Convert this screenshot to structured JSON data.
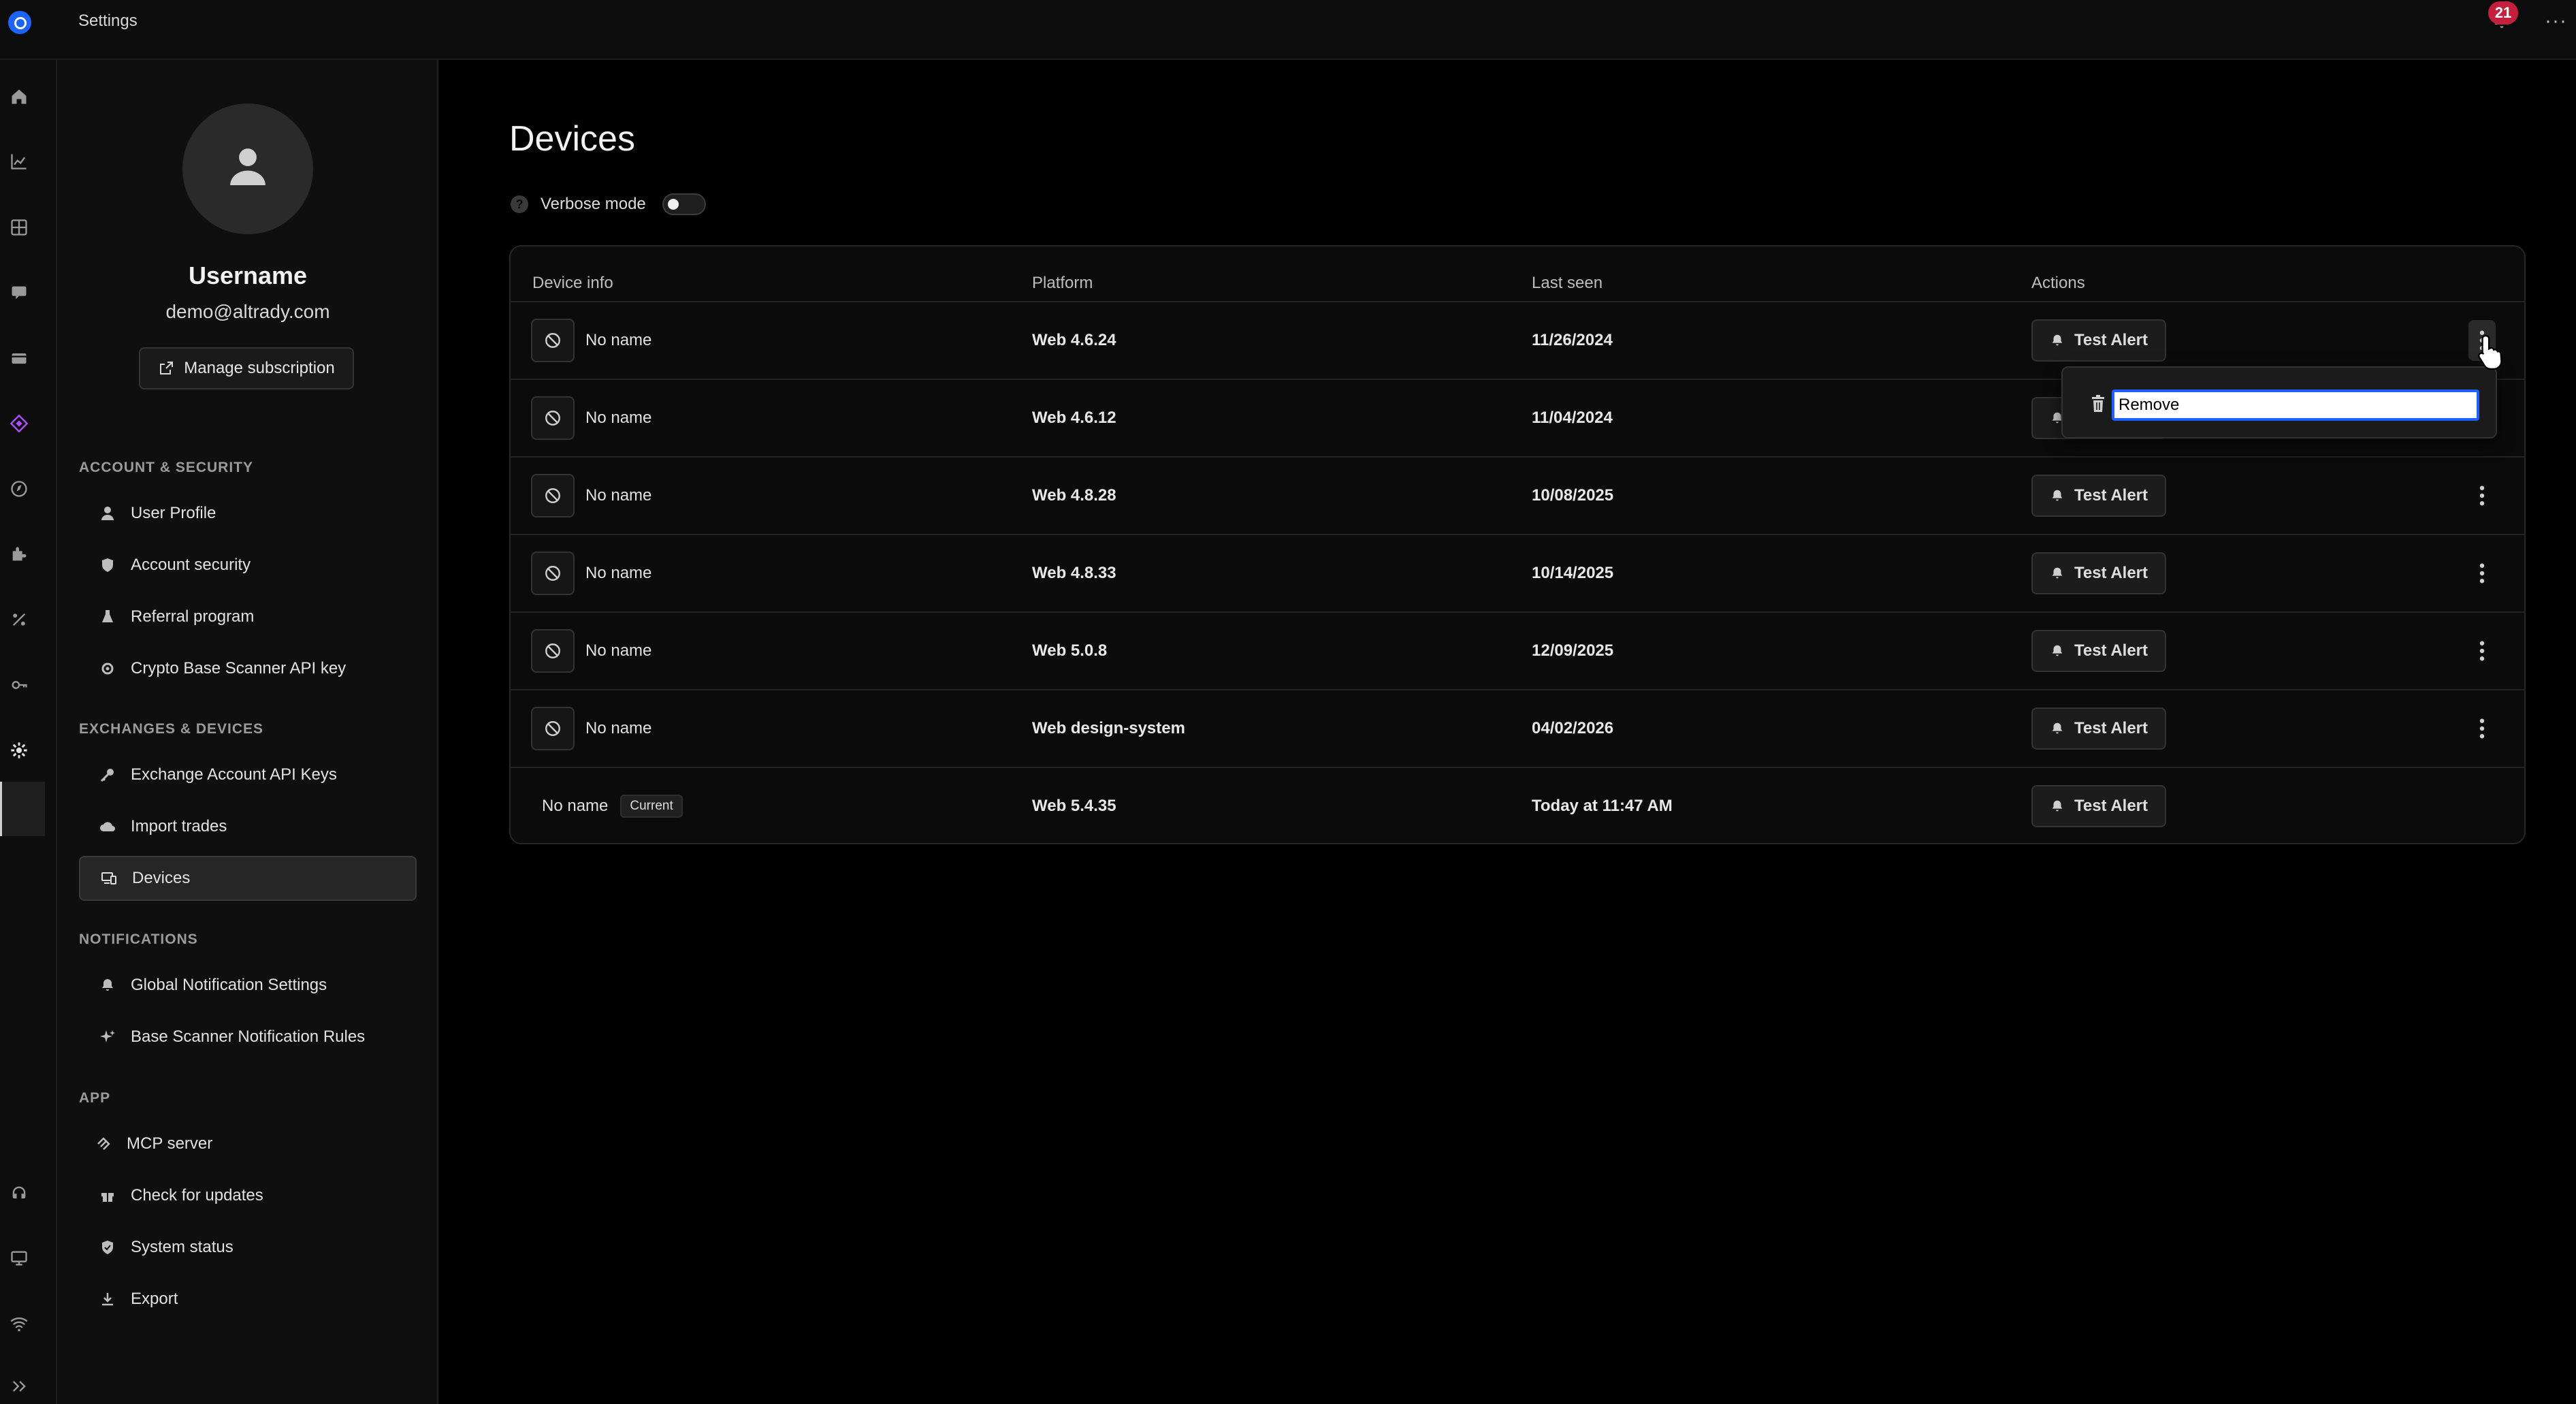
{
  "topbar": {
    "title": "Settings",
    "notification_count": "21",
    "more": "···"
  },
  "rail": {
    "icons": [
      "home-icon",
      "chart-icon",
      "grid-icon",
      "chat-icon",
      "wallet-icon",
      "tag-icon",
      "compass-icon",
      "puzzle-icon",
      "percent-icon",
      "key-icon",
      "gear-icon",
      "support-icon",
      "desktop-icon",
      "wifi-icon",
      "expand-icon"
    ]
  },
  "profile": {
    "username": "Username",
    "email": "demo@altrady.com",
    "manage_label": "Manage subscription"
  },
  "sidebar": {
    "sections": [
      {
        "title": "ACCOUNT & SECURITY",
        "items": [
          {
            "label": "User Profile",
            "icon": "user-icon"
          },
          {
            "label": "Account security",
            "icon": "shield-icon"
          },
          {
            "label": "Referral program",
            "icon": "flask-icon"
          },
          {
            "label": "Crypto Base Scanner API key",
            "icon": "cog-icon"
          }
        ]
      },
      {
        "title": "EXCHANGES & DEVICES",
        "items": [
          {
            "label": "Exchange Account API Keys",
            "icon": "key-icon"
          },
          {
            "label": "Import trades",
            "icon": "cloud-upload-icon"
          },
          {
            "label": "Devices",
            "icon": "devices-icon"
          }
        ]
      },
      {
        "title": "NOTIFICATIONS",
        "items": [
          {
            "label": "Global Notification Settings",
            "icon": "bell-icon"
          },
          {
            "label": "Base Scanner Notification Rules",
            "icon": "sparkle-icon"
          }
        ]
      },
      {
        "title": "APP",
        "items": [
          {
            "label": "MCP server",
            "icon": "mcp-icon"
          },
          {
            "label": "Check for updates",
            "icon": "gift-icon"
          },
          {
            "label": "System status",
            "icon": "shield-check-icon"
          },
          {
            "label": "Export",
            "icon": "download-icon"
          }
        ]
      }
    ]
  },
  "main": {
    "title": "Devices",
    "verbose_label": "Verbose mode",
    "verbose_enabled": false
  },
  "table": {
    "headers": [
      "Device info",
      "Platform",
      "Last seen",
      "Actions"
    ],
    "test_alert_label": "Test Alert",
    "rows": [
      {
        "name": "No name",
        "platform": "Web 4.6.24",
        "last_seen": "11/26/2024"
      },
      {
        "name": "No name",
        "platform": "Web 4.6.12",
        "last_seen": "11/04/2024"
      },
      {
        "name": "No name",
        "platform": "Web 4.8.28",
        "last_seen": "10/08/2025"
      },
      {
        "name": "No name",
        "platform": "Web 4.8.33",
        "last_seen": "10/14/2025"
      },
      {
        "name": "No name",
        "platform": "Web 5.0.8",
        "last_seen": "12/09/2025"
      },
      {
        "name": "No name",
        "platform": "Web design-system",
        "last_seen": "04/02/2026"
      },
      {
        "name": "No name",
        "badge": "Current",
        "platform": "Web 5.4.35",
        "last_seen": "Today at 11:47 AM"
      }
    ]
  },
  "popover": {
    "remove_value": "Remove"
  }
}
